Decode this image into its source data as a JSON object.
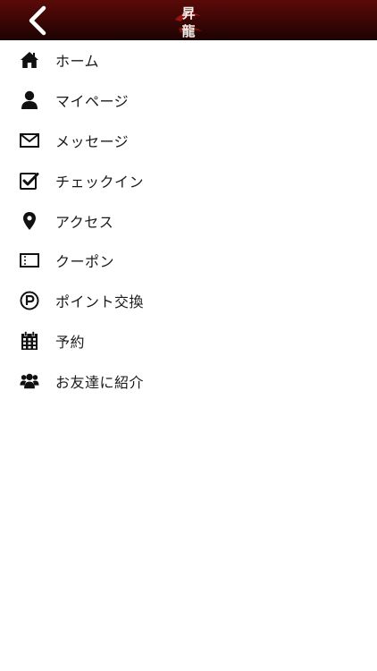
{
  "header": {
    "back_icon": "chevron-left-icon",
    "logo": "昇龍",
    "background_color": "#3a0605"
  },
  "menu": {
    "items": [
      {
        "label": "ホーム",
        "icon": "home-icon"
      },
      {
        "label": "マイページ",
        "icon": "user-icon"
      },
      {
        "label": "メッセージ",
        "icon": "envelope-icon"
      },
      {
        "label": "チェックイン",
        "icon": "checkbox-icon"
      },
      {
        "label": "アクセス",
        "icon": "map-pin-icon"
      },
      {
        "label": "クーポン",
        "icon": "ticket-icon"
      },
      {
        "label": "ポイント交換",
        "icon": "point-circle-icon"
      },
      {
        "label": "予約",
        "icon": "calendar-icon"
      },
      {
        "label": "お友達に紹介",
        "icon": "users-icon"
      }
    ]
  }
}
